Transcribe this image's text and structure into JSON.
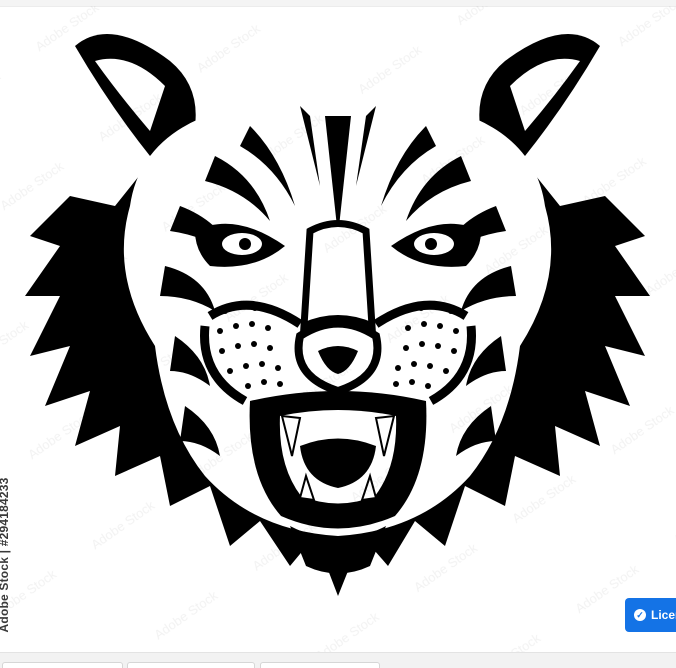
{
  "image": {
    "alt": "Tiger head",
    "watermark_text": "Adobe Stock",
    "stock_id_text": "Adobe Stock | #294184233"
  },
  "actions": {
    "license_label": "Licen",
    "license_icon": "check-circle-icon"
  },
  "colors": {
    "accent": "#1473e6",
    "ink": "#000000",
    "background": "#ffffff"
  }
}
